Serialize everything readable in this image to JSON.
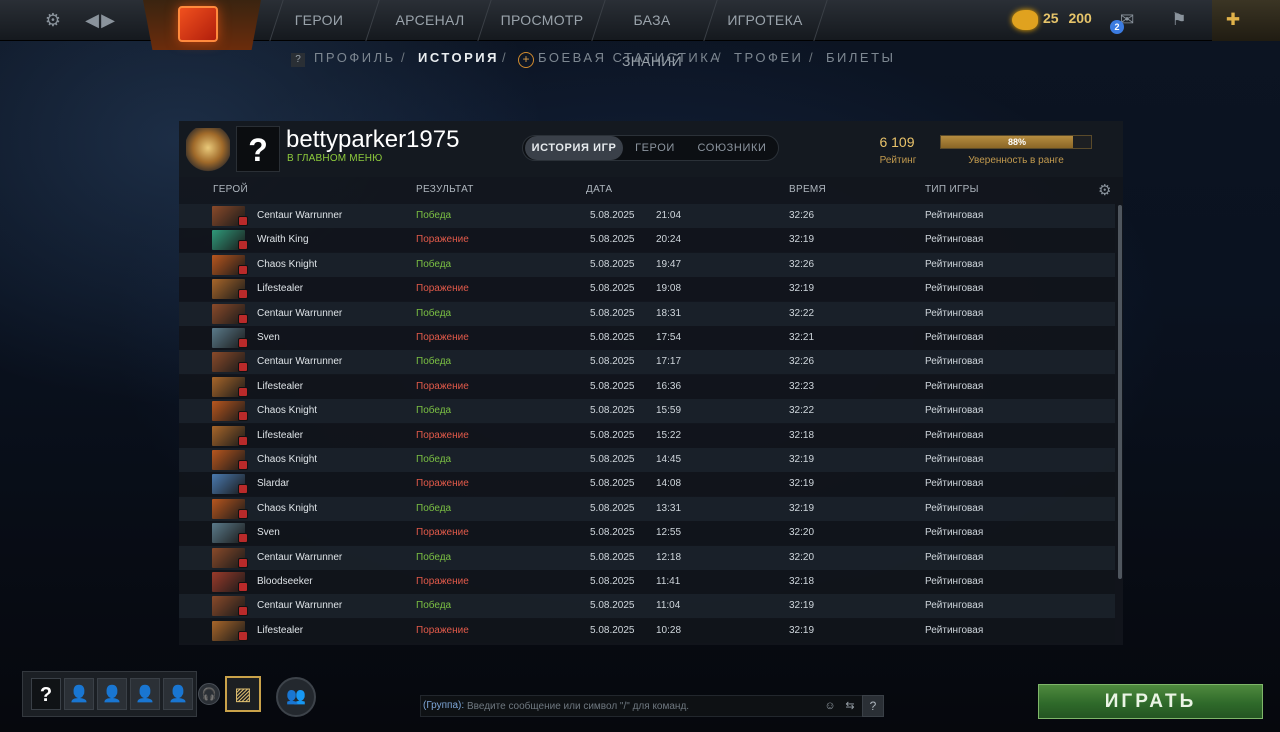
{
  "topnav": {
    "tabs": [
      "ГЕРОИ",
      "АРСЕНАЛ",
      "ПРОСМОТР",
      "БАЗА ЗНАНИЙ",
      "ИГРОТЕКА"
    ],
    "coins": [
      "25",
      "200"
    ],
    "notification_count": "2"
  },
  "subnav": {
    "items": [
      "ПРОФИЛЬ",
      "ИСТОРИЯ",
      "БОЕВАЯ СТАТИСТИКА",
      "ТРОФЕИ",
      "БИЛЕТЫ"
    ],
    "active": "ИСТОРИЯ",
    "separator": "/",
    "help_glyph": "?"
  },
  "profile": {
    "avatar_glyph": "?",
    "username": "bettyparker1975",
    "status": "В ГЛАВНОМ МЕНЮ",
    "tabs": [
      "ИСТОРИЯ ИГР",
      "ГЕРОИ",
      "СОЮЗНИКИ"
    ],
    "active_tab": "ИСТОРИЯ ИГР",
    "rating_value": "6 109",
    "rating_label": "Рейтинг",
    "confidence_text": "88%",
    "confidence_fraction": 0.88,
    "confidence_label": "Уверенность в ранге"
  },
  "table": {
    "headers": {
      "hero": "ГЕРОЙ",
      "result": "РЕЗУЛЬТАТ",
      "date": "ДАТА",
      "duration": "ВРЕМЯ",
      "type": "ТИП ИГРЫ"
    },
    "rows": [
      {
        "hero": "Centaur Warrunner",
        "result": "Победа",
        "win": true,
        "date": "5.08.2025",
        "time": "21:04",
        "duration": "32:26",
        "type": "Рейтинговая",
        "color": "#8a4a2a"
      },
      {
        "hero": "Wraith King",
        "result": "Поражение",
        "win": false,
        "date": "5.08.2025",
        "time": "20:24",
        "duration": "32:19",
        "type": "Рейтинговая",
        "color": "#2f9a7a"
      },
      {
        "hero": "Chaos Knight",
        "result": "Победа",
        "win": true,
        "date": "5.08.2025",
        "time": "19:47",
        "duration": "32:26",
        "type": "Рейтинговая",
        "color": "#b8561e"
      },
      {
        "hero": "Lifestealer",
        "result": "Поражение",
        "win": false,
        "date": "5.08.2025",
        "time": "19:08",
        "duration": "32:19",
        "type": "Рейтинговая",
        "color": "#a8662a"
      },
      {
        "hero": "Centaur Warrunner",
        "result": "Победа",
        "win": true,
        "date": "5.08.2025",
        "time": "18:31",
        "duration": "32:22",
        "type": "Рейтинговая",
        "color": "#8a4a2a"
      },
      {
        "hero": "Sven",
        "result": "Поражение",
        "win": false,
        "date": "5.08.2025",
        "time": "17:54",
        "duration": "32:21",
        "type": "Рейтинговая",
        "color": "#5a7a8a"
      },
      {
        "hero": "Centaur Warrunner",
        "result": "Победа",
        "win": true,
        "date": "5.08.2025",
        "time": "17:17",
        "duration": "32:26",
        "type": "Рейтинговая",
        "color": "#8a4a2a"
      },
      {
        "hero": "Lifestealer",
        "result": "Поражение",
        "win": false,
        "date": "5.08.2025",
        "time": "16:36",
        "duration": "32:23",
        "type": "Рейтинговая",
        "color": "#a8662a"
      },
      {
        "hero": "Chaos Knight",
        "result": "Победа",
        "win": true,
        "date": "5.08.2025",
        "time": "15:59",
        "duration": "32:22",
        "type": "Рейтинговая",
        "color": "#b8561e"
      },
      {
        "hero": "Lifestealer",
        "result": "Поражение",
        "win": false,
        "date": "5.08.2025",
        "time": "15:22",
        "duration": "32:18",
        "type": "Рейтинговая",
        "color": "#a8662a"
      },
      {
        "hero": "Chaos Knight",
        "result": "Победа",
        "win": true,
        "date": "5.08.2025",
        "time": "14:45",
        "duration": "32:19",
        "type": "Рейтинговая",
        "color": "#b8561e"
      },
      {
        "hero": "Slardar",
        "result": "Поражение",
        "win": false,
        "date": "5.08.2025",
        "time": "14:08",
        "duration": "32:19",
        "type": "Рейтинговая",
        "color": "#4a7ab0"
      },
      {
        "hero": "Chaos Knight",
        "result": "Победа",
        "win": true,
        "date": "5.08.2025",
        "time": "13:31",
        "duration": "32:19",
        "type": "Рейтинговая",
        "color": "#b8561e"
      },
      {
        "hero": "Sven",
        "result": "Поражение",
        "win": false,
        "date": "5.08.2025",
        "time": "12:55",
        "duration": "32:20",
        "type": "Рейтинговая",
        "color": "#5a7a8a"
      },
      {
        "hero": "Centaur Warrunner",
        "result": "Победа",
        "win": true,
        "date": "5.08.2025",
        "time": "12:18",
        "duration": "32:20",
        "type": "Рейтинговая",
        "color": "#8a4a2a"
      },
      {
        "hero": "Bloodseeker",
        "result": "Поражение",
        "win": false,
        "date": "5.08.2025",
        "time": "11:41",
        "duration": "32:18",
        "type": "Рейтинговая",
        "color": "#9a3a2a"
      },
      {
        "hero": "Centaur Warrunner",
        "result": "Победа",
        "win": true,
        "date": "5.08.2025",
        "time": "11:04",
        "duration": "32:19",
        "type": "Рейтинговая",
        "color": "#8a4a2a"
      },
      {
        "hero": "Lifestealer",
        "result": "Поражение",
        "win": false,
        "date": "5.08.2025",
        "time": "10:28",
        "duration": "32:19",
        "type": "Рейтинговая",
        "color": "#a8662a"
      }
    ]
  },
  "bottom": {
    "party_glyph": "?",
    "chat_label": "(Группа):",
    "chat_placeholder": "Введите сообщение или символ \"/\" для команд.",
    "chat_help": "?",
    "play_label": "ИГРАТЬ"
  },
  "colors": {
    "win": "#7bc043",
    "loss": "#e25a4a",
    "accent_gold": "#e9c36a",
    "play_green": "#3f7a34"
  }
}
